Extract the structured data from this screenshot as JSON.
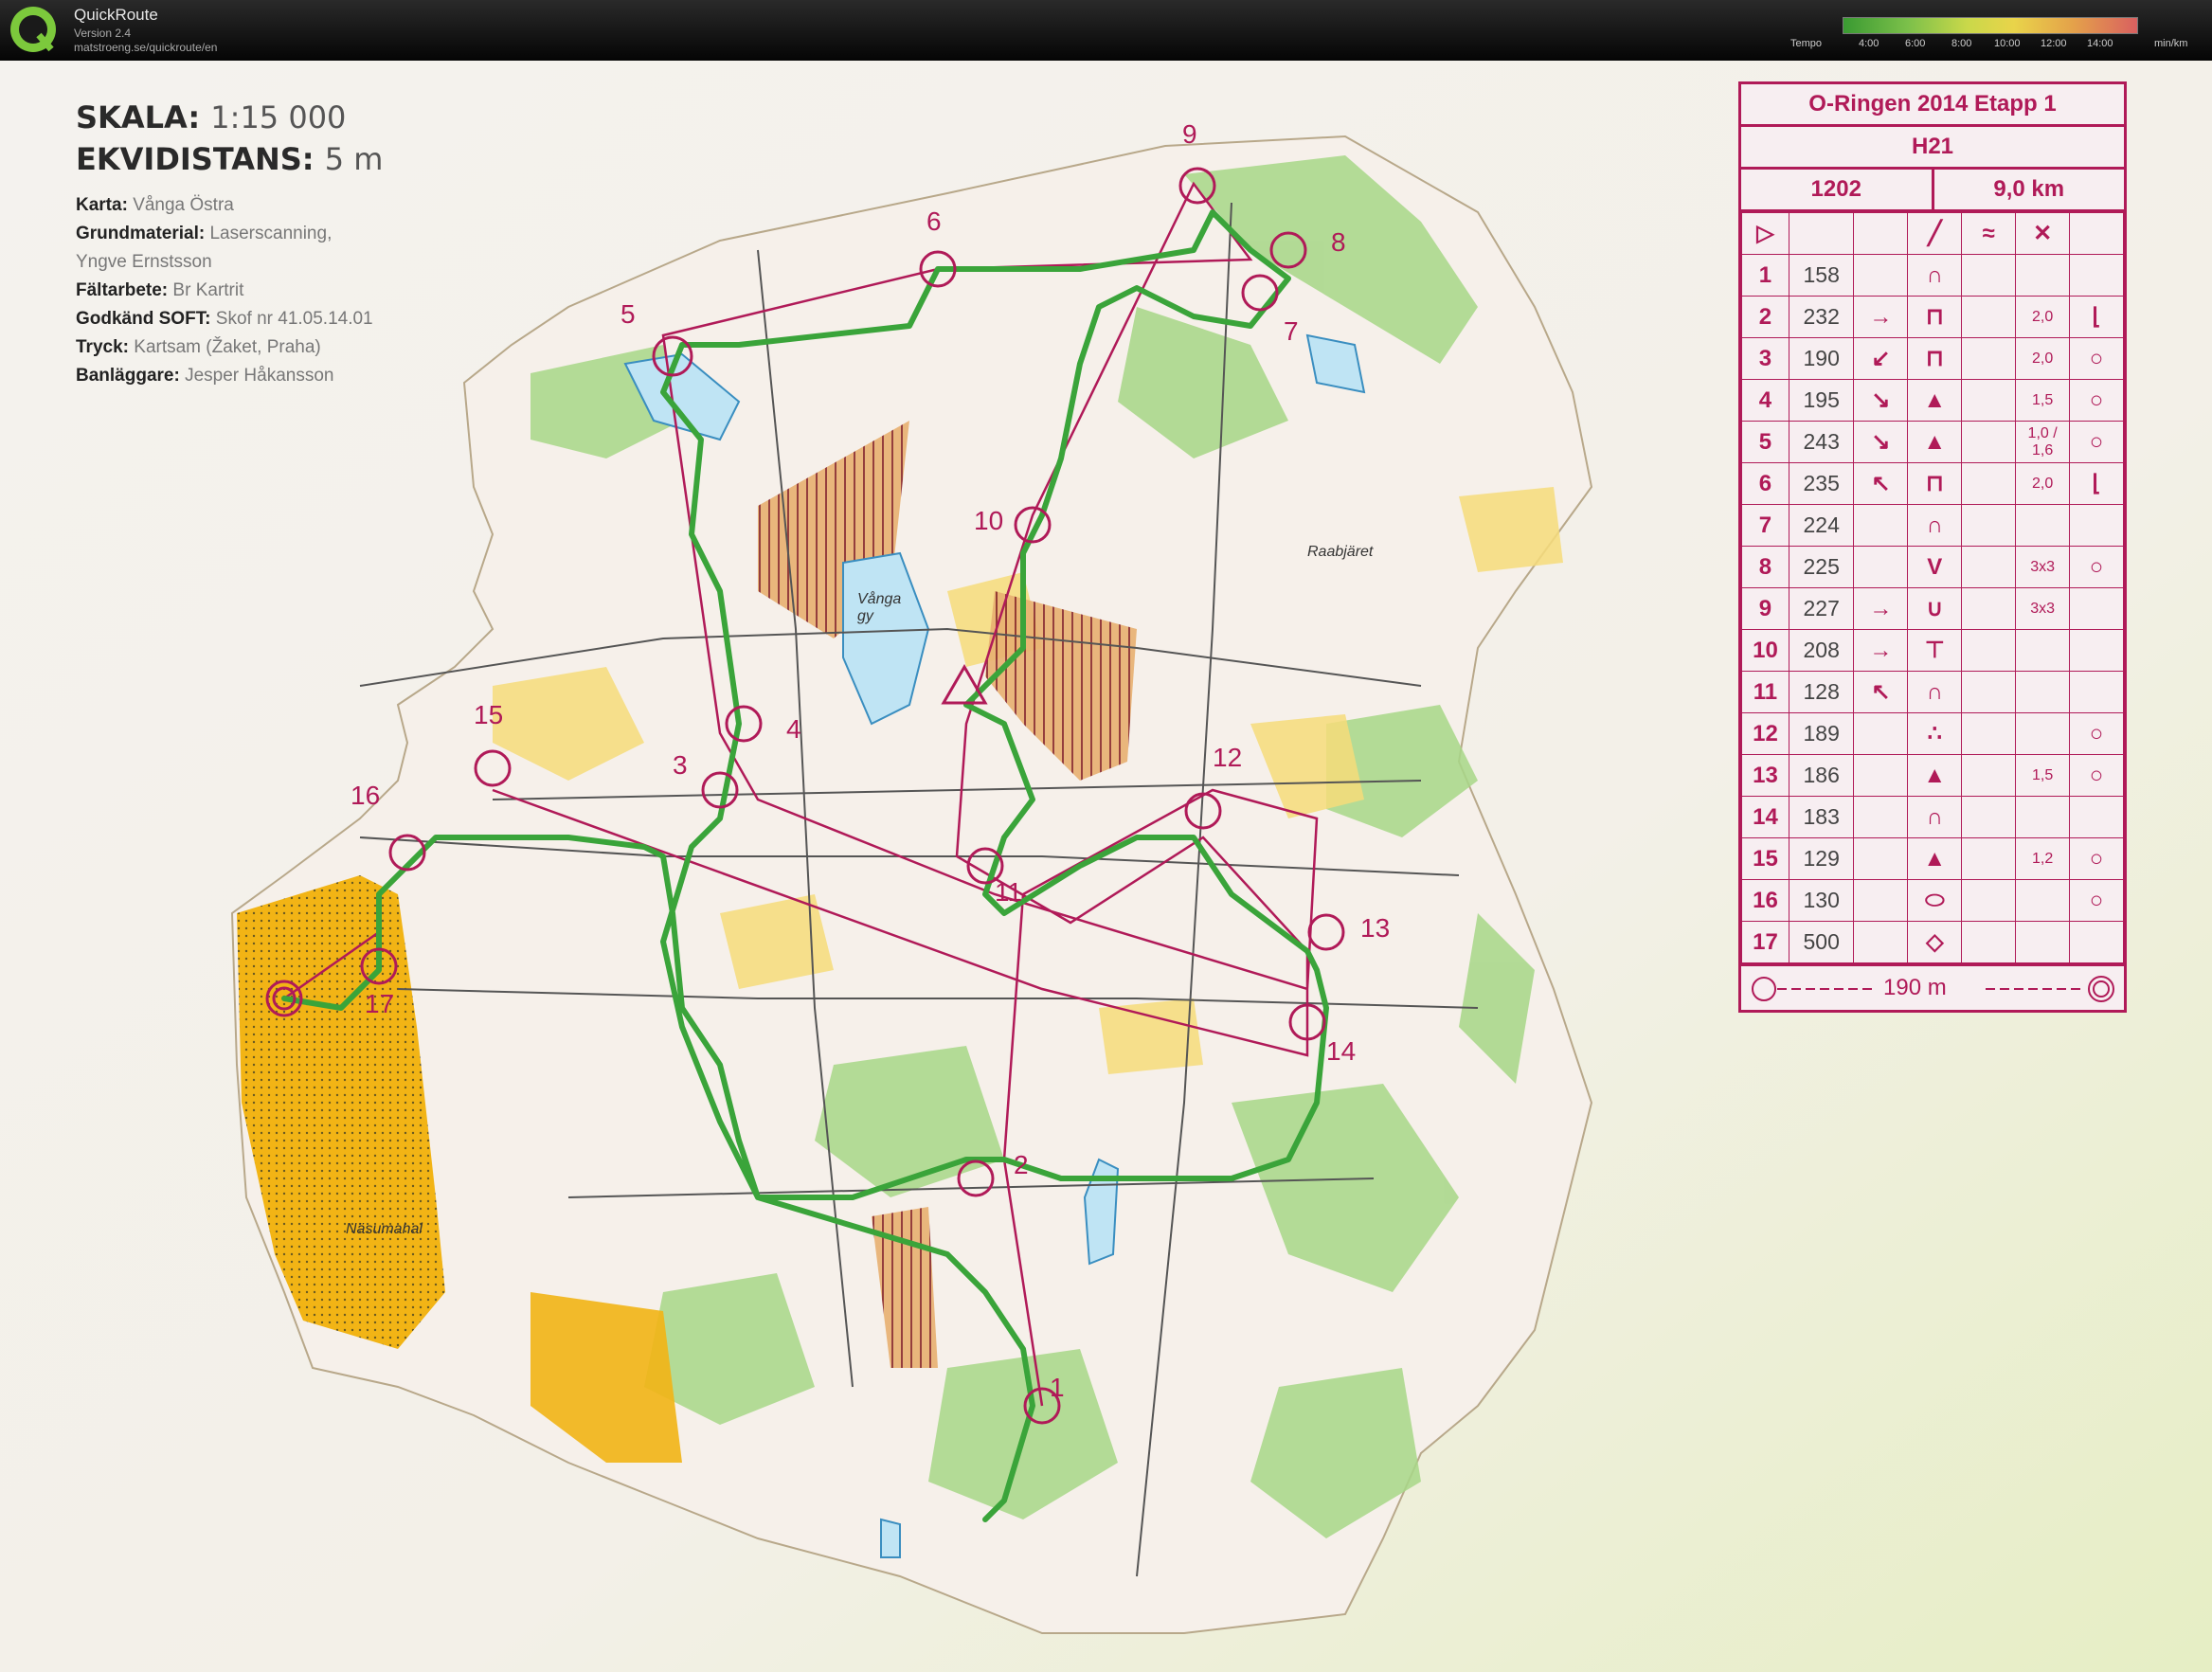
{
  "app": {
    "title": "QuickRoute",
    "version": "Version 2.4",
    "url": "matstroeng.se/quickroute/en"
  },
  "tempo": {
    "label": "Tempo",
    "ticks": [
      "4:00",
      "6:00",
      "8:00",
      "10:00",
      "12:00",
      "14:00"
    ],
    "unit": "min/km"
  },
  "map_info": {
    "scale_label": "SKALA:",
    "scale_value": "1:15 000",
    "equidistance_label": "EKVIDISTANS:",
    "equidistance_value": "5 m",
    "rows": [
      {
        "key": "Karta:",
        "value": "Vånga Östra"
      },
      {
        "key": "Grundmaterial:",
        "value": "Laserscanning,"
      },
      {
        "key": "",
        "value": "Yngve Ernstsson"
      },
      {
        "key": "Fältarbete:",
        "value": "Br Kartrit"
      },
      {
        "key": "Godkänd SOFT:",
        "value": "Skof nr 41.05.14.01"
      },
      {
        "key": "Tryck:",
        "value": "Kartsam (Žaket, Praha)"
      },
      {
        "key": "Banläggare:",
        "value": "Jesper Håkansson"
      }
    ]
  },
  "control_card": {
    "event": "O-Ringen 2014 Etapp 1",
    "class": "H21",
    "code": "1202",
    "length": "9,0 km",
    "controls": [
      {
        "n": "1",
        "code": "158",
        "dir": "",
        "feat": "∩",
        "dim": "",
        "extra": ""
      },
      {
        "n": "2",
        "code": "232",
        "dir": "→",
        "feat": "⊓",
        "dim": "2,0",
        "extra": "⌊"
      },
      {
        "n": "3",
        "code": "190",
        "dir": "↙",
        "feat": "⊓",
        "dim": "2,0",
        "extra": "○"
      },
      {
        "n": "4",
        "code": "195",
        "dir": "↘",
        "feat": "▲",
        "dim": "1,5",
        "extra": "○"
      },
      {
        "n": "5",
        "code": "243",
        "dir": "↘",
        "feat": "▲",
        "dim": "1,0 / 1,6",
        "extra": "○"
      },
      {
        "n": "6",
        "code": "235",
        "dir": "↖",
        "feat": "⊓",
        "dim": "2,0",
        "extra": "⌊"
      },
      {
        "n": "7",
        "code": "224",
        "dir": "",
        "feat": "∩",
        "dim": "",
        "extra": ""
      },
      {
        "n": "8",
        "code": "225",
        "dir": "",
        "feat": "V",
        "dim": "3x3",
        "extra": "○"
      },
      {
        "n": "9",
        "code": "227",
        "dir": "→",
        "feat": "∪",
        "dim": "3x3",
        "extra": ""
      },
      {
        "n": "10",
        "code": "208",
        "dir": "→",
        "feat": "⊤",
        "dim": "",
        "extra": ""
      },
      {
        "n": "11",
        "code": "128",
        "dir": "↖",
        "feat": "∩",
        "dim": "",
        "extra": ""
      },
      {
        "n": "12",
        "code": "189",
        "dir": "",
        "feat": "∴",
        "dim": "",
        "extra": "○"
      },
      {
        "n": "13",
        "code": "186",
        "dir": "",
        "feat": "▲",
        "dim": "1,5",
        "extra": "○"
      },
      {
        "n": "14",
        "code": "183",
        "dir": "",
        "feat": "∩",
        "dim": "",
        "extra": ""
      },
      {
        "n": "15",
        "code": "129",
        "dir": "",
        "feat": "▲",
        "dim": "1,2",
        "extra": "○"
      },
      {
        "n": "16",
        "code": "130",
        "dir": "",
        "feat": "⬭",
        "dim": "",
        "extra": "○"
      },
      {
        "n": "17",
        "code": "500",
        "dir": "",
        "feat": "◇",
        "dim": "",
        "extra": ""
      }
    ],
    "finish_distance": "190 m"
  },
  "map_labels": {
    "lake": "Vånga gy",
    "farm": "Raabjäret",
    "field": "Näsumahal"
  },
  "control_numbers": [
    "1",
    "2",
    "3",
    "4",
    "5",
    "6",
    "7",
    "8",
    "9",
    "10",
    "11",
    "12",
    "13",
    "14",
    "15",
    "16",
    "17"
  ],
  "colors": {
    "course": "#b01a58",
    "route": "#3aa43a",
    "field": "#f0b20a",
    "forest_green": "#9fd27a",
    "water": "#bfe4f4"
  }
}
